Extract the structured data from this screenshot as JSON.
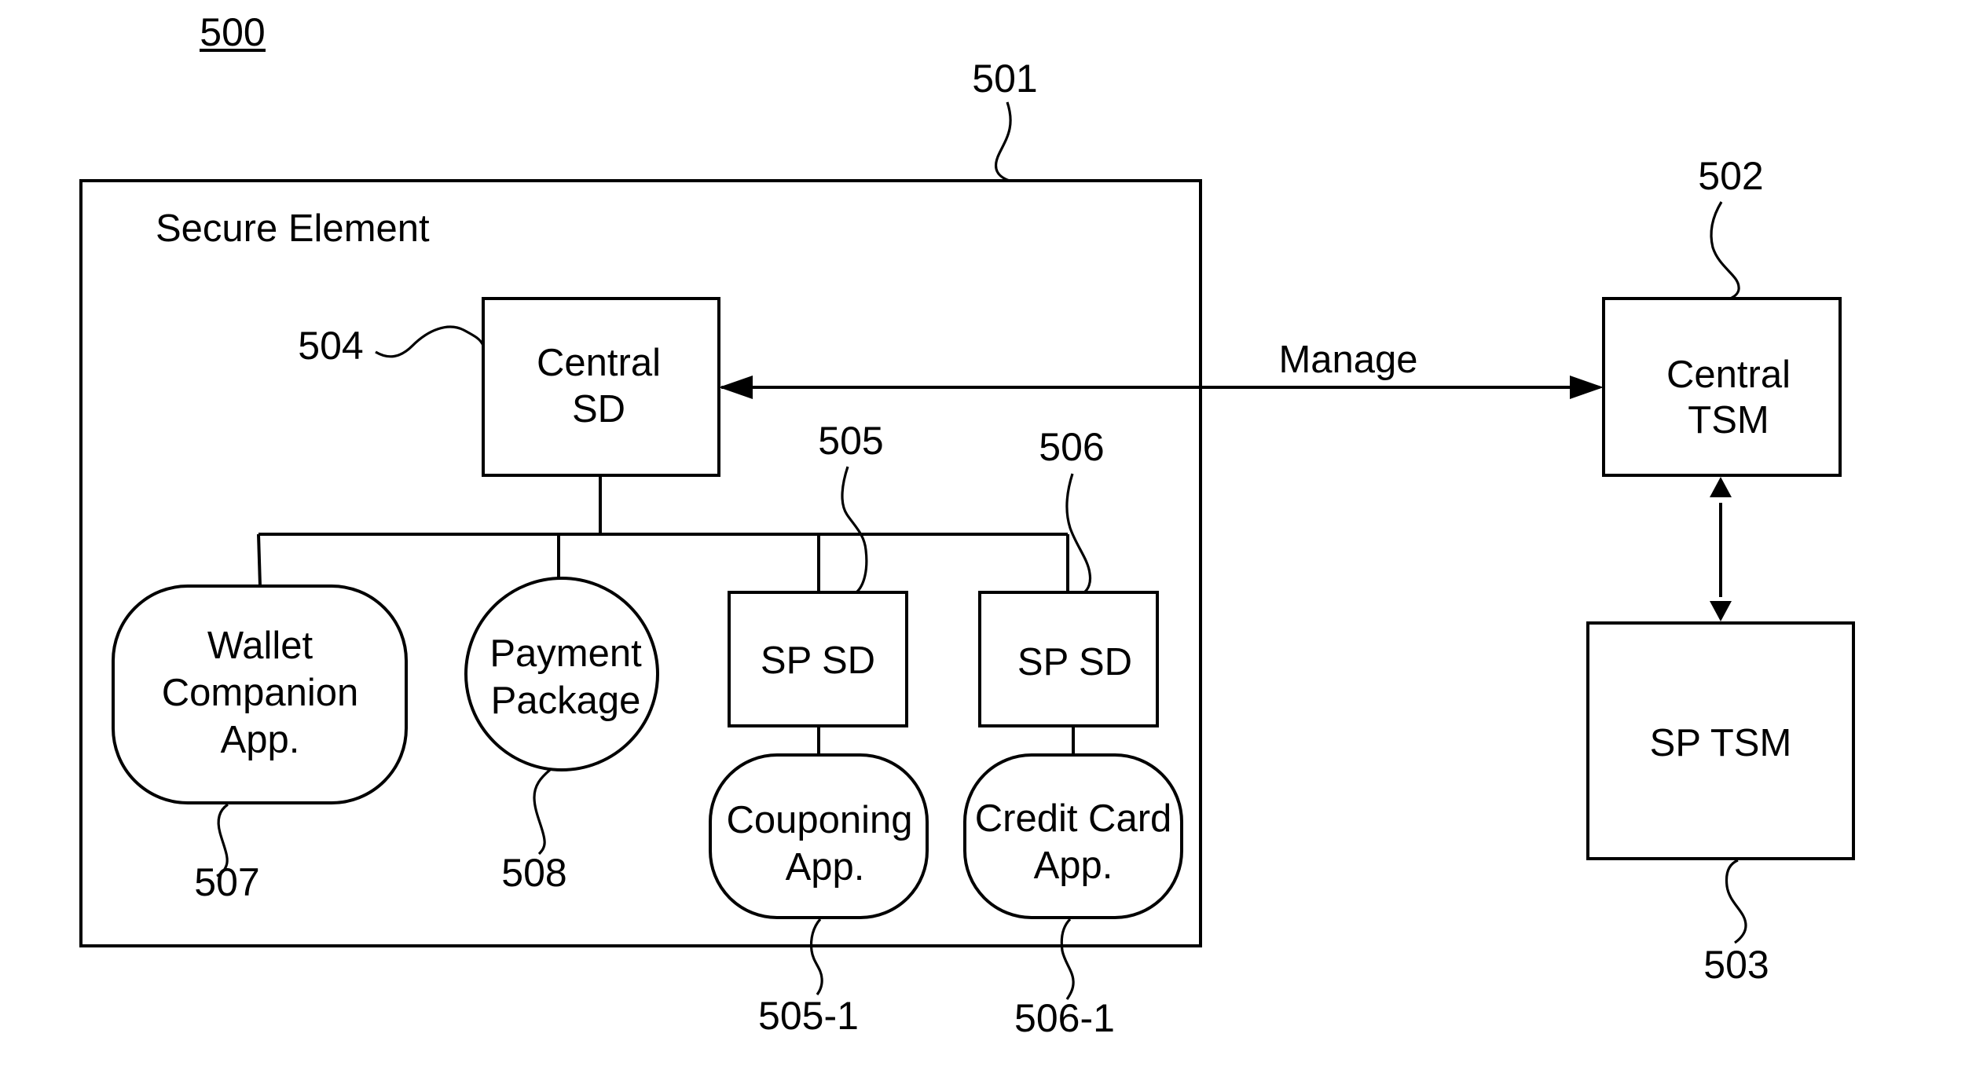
{
  "figure": {
    "number": "500",
    "colors": {
      "line": "#000000",
      "background": "#ffffff"
    }
  },
  "secure_element": {
    "ref": "501",
    "title": "Secure Element",
    "central_sd": {
      "ref": "504",
      "lines": [
        "Central",
        "SD"
      ]
    },
    "wallet_app": {
      "ref": "507",
      "lines": [
        "Wallet",
        "Companion",
        "App."
      ]
    },
    "payment_package": {
      "ref": "508",
      "lines": [
        "Payment",
        "Package"
      ]
    },
    "sp_sd_1": {
      "ref": "505",
      "label": "SP SD"
    },
    "sp_sd_2": {
      "ref": "506",
      "label": "SP SD"
    },
    "couponing_app": {
      "ref": "505-1",
      "lines": [
        "Couponing",
        "App."
      ]
    },
    "credit_card_app": {
      "ref": "506-1",
      "lines": [
        "Credit Card",
        "App."
      ]
    }
  },
  "central_tsm": {
    "ref": "502",
    "lines": [
      "Central",
      "TSM"
    ]
  },
  "sp_tsm": {
    "ref": "503",
    "label": "SP TSM"
  },
  "connections": {
    "manage_label": "Manage",
    "manage_arrow": "bidirectional",
    "tsm_link_arrow": "bidirectional"
  }
}
